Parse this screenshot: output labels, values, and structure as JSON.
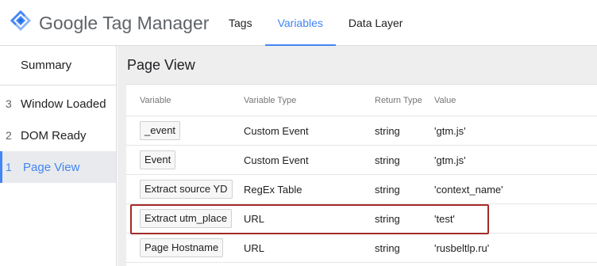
{
  "header": {
    "brand": "Google Tag Manager",
    "tabs": [
      {
        "label": "Tags"
      },
      {
        "label": "Variables"
      },
      {
        "label": "Data Layer"
      }
    ],
    "active_tab": "Variables"
  },
  "sidebar": {
    "summary_label": "Summary",
    "items": [
      {
        "num": "3",
        "label": "Window Loaded"
      },
      {
        "num": "2",
        "label": "DOM Ready"
      },
      {
        "num": "1",
        "label": "Page View"
      }
    ],
    "active_item": "Page View"
  },
  "main": {
    "title": "Page View",
    "columns": [
      "Variable",
      "Variable Type",
      "Return Type",
      "Value"
    ],
    "rows": [
      {
        "variable": "_event",
        "type": "Custom Event",
        "return_type": "string",
        "value": "'gtm.js'"
      },
      {
        "variable": "Event",
        "type": "Custom Event",
        "return_type": "string",
        "value": "'gtm.js'"
      },
      {
        "variable": "Extract source YD",
        "type": "RegEx Table",
        "return_type": "string",
        "value": "'context_name'"
      },
      {
        "variable": "Extract utm_place",
        "type": "URL",
        "return_type": "string",
        "value": "'test'"
      },
      {
        "variable": "Page Hostname",
        "type": "URL",
        "return_type": "string",
        "value": "'rusbeltlp.ru'"
      }
    ],
    "highlighted_row": "Extract utm_place"
  },
  "colors": {
    "accent": "#4285f4",
    "highlight_border": "#a52a2a",
    "logo_blue": "#4285f4",
    "logo_dark_blue": "#1a73e8",
    "logo_light_blue": "#8ab4f8"
  },
  "icons": {
    "logo": "gtm-diamond-icon"
  }
}
